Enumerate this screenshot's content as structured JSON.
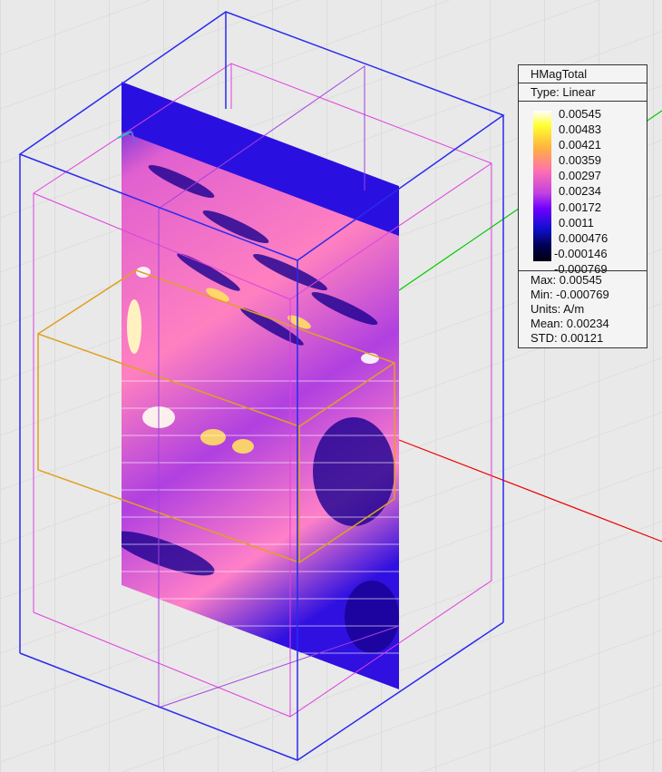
{
  "legend": {
    "title": "HMagTotal",
    "type": "Type: Linear",
    "ticks": [
      "0.00545",
      "0.00483",
      "0.00421",
      "0.00359",
      "0.00297",
      "0.00234",
      "0.00172",
      "0.0011",
      "0.000476",
      "-0.000146",
      "-0.000769"
    ],
    "stats": {
      "max": "Max: 0.00545",
      "min": "Min: -0.000769",
      "units": "Units: A/m",
      "mean": "Mean: 0.00234",
      "std": "STD: 0.00121"
    }
  },
  "colors": {
    "outer_box": "#2a2aee",
    "inner_box": "#e040e0",
    "port_box": "#e0a020",
    "x_axis": "#ee0000",
    "y_axis": "#00cc00"
  }
}
